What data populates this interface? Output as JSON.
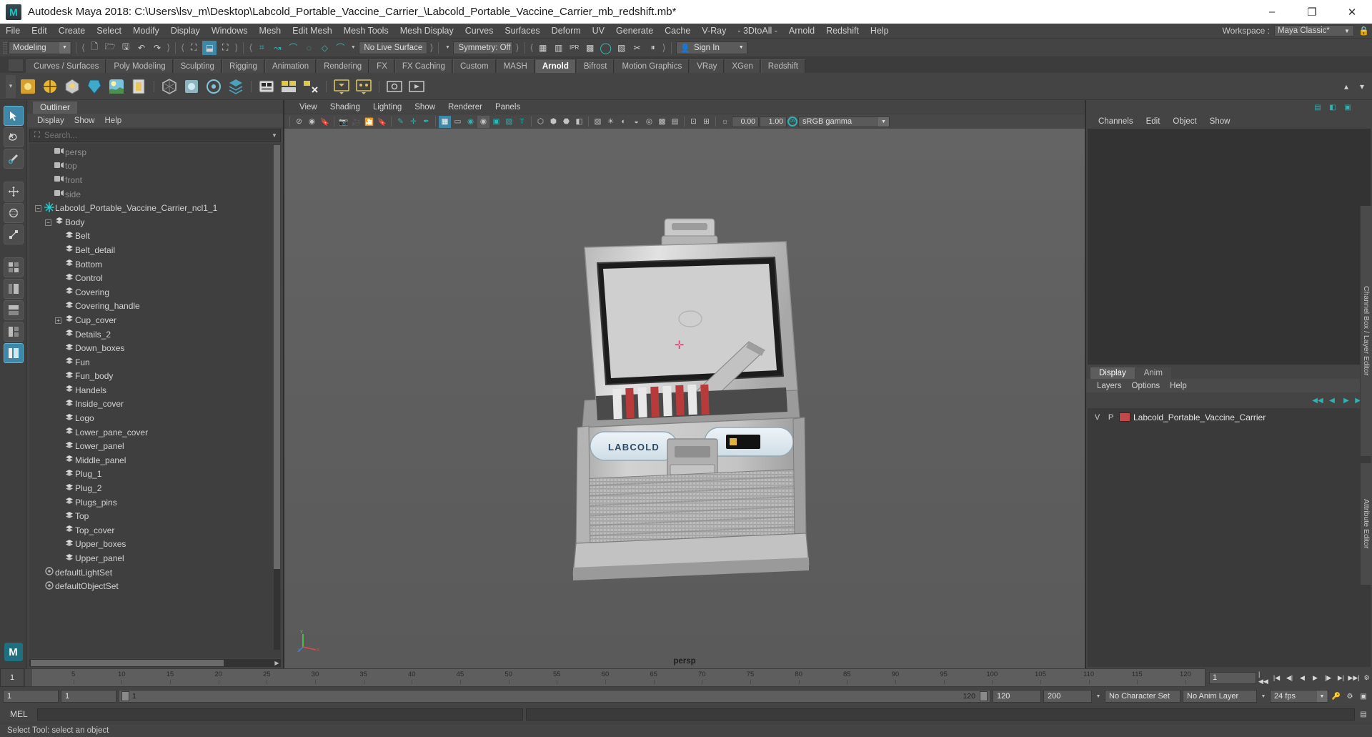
{
  "window": {
    "title": "Autodesk Maya 2018: C:\\Users\\lsv_m\\Desktop\\Labcold_Portable_Vaccine_Carrier_\\Labcold_Portable_Vaccine_Carrier_mb_redshift.mb*",
    "logo": "M",
    "minimize": "–",
    "maximize": "❐",
    "close": "✕"
  },
  "menubar": {
    "items": [
      "File",
      "Edit",
      "Create",
      "Select",
      "Modify",
      "Display",
      "Windows",
      "Mesh",
      "Edit Mesh",
      "Mesh Tools",
      "Mesh Display",
      "Curves",
      "Surfaces",
      "Deform",
      "UV",
      "Generate",
      "Cache",
      "V-Ray",
      "- 3DtoAll -",
      "Arnold",
      "Redshift",
      "Help"
    ],
    "workspace_label": "Workspace :",
    "workspace_value": "Maya Classic*",
    "lock_icon": "lock-icon"
  },
  "statusline": {
    "mode": "Modeling",
    "live_surface": "No Live Surface",
    "symmetry": "Symmetry: Off",
    "signin": "Sign In",
    "icons": [
      "new-scene-icon",
      "open-scene-icon",
      "save-scene-icon",
      "undo-icon",
      "redo-icon",
      "select-hierarchy-icon",
      "select-object-icon",
      "select-component-icon",
      "snap-grid-icon",
      "snap-curve-icon",
      "snap-point-icon",
      "snap-projected-icon",
      "snap-view-plane-icon",
      "magnet-icon",
      "render-current-frame-icon",
      "ipr-render-icon",
      "render-settings-icon",
      "hypershade-icon",
      "render-view-icon",
      "toggle-render-icon",
      "pause-icon"
    ]
  },
  "shelf": {
    "tabs": [
      "Curves / Surfaces",
      "Poly Modeling",
      "Sculpting",
      "Rigging",
      "Animation",
      "Rendering",
      "FX",
      "FX Caching",
      "Custom",
      "MASH",
      "Arnold",
      "Bifrost",
      "Motion Graphics",
      "VRay",
      "XGen",
      "Redshift"
    ],
    "active_tab": "Arnold",
    "buttons": [
      "arnold-area-light-icon",
      "arnold-skydome-light-icon",
      "arnold-mesh-light-icon",
      "arnold-photometric-light-icon",
      "arnold-physical-sky-icon",
      "arnold-light-portal-icon",
      "arnold-standin-icon",
      "arnold-volume-icon",
      "arnold-procedural-icon",
      "arnold-scene-source-icon",
      "arnold-flare-icon",
      "arnold-bifrost-icon",
      "arnold-utility-icon",
      "arnold-render-view-icon",
      "arnold-sequence-icon"
    ]
  },
  "toolbox": {
    "tools": [
      "select-tool",
      "lasso-select-tool",
      "paint-select-tool",
      "move-tool",
      "rotate-tool",
      "scale-tool",
      "last-tool",
      "show-manipulator-tool",
      "layout-quad-icon",
      "layout-persp-outliner-icon",
      "layout-persp-graph-icon",
      "layout-hypershade-icon",
      "layout-outliner-persp-icon"
    ],
    "selected": "select-tool",
    "badge": "M"
  },
  "outliner": {
    "tab": "Outliner",
    "menus": [
      "Display",
      "Show",
      "Help"
    ],
    "search_placeholder": "Search...",
    "search_icon": "search-icon",
    "nodes": [
      {
        "label": "persp",
        "icon": "camera-icon",
        "depth": 1,
        "dim": true,
        "expander": "none"
      },
      {
        "label": "top",
        "icon": "camera-icon",
        "depth": 1,
        "dim": true,
        "expander": "none"
      },
      {
        "label": "front",
        "icon": "camera-icon",
        "depth": 1,
        "dim": true,
        "expander": "none"
      },
      {
        "label": "side",
        "icon": "camera-icon",
        "depth": 1,
        "dim": true,
        "expander": "none"
      },
      {
        "label": "Labcold_Portable_Vaccine_Carrier_ncl1_1",
        "icon": "nucleus-icon",
        "depth": 0,
        "dim": false,
        "expander": "minus"
      },
      {
        "label": "Body",
        "icon": "mesh-icon",
        "depth": 1,
        "dim": false,
        "expander": "minus"
      },
      {
        "label": "Belt",
        "icon": "mesh-icon",
        "depth": 2,
        "dim": false,
        "expander": "dot"
      },
      {
        "label": "Belt_detail",
        "icon": "mesh-icon",
        "depth": 2,
        "dim": false,
        "expander": "dot"
      },
      {
        "label": "Bottom",
        "icon": "mesh-icon",
        "depth": 2,
        "dim": false,
        "expander": "dot"
      },
      {
        "label": "Control",
        "icon": "mesh-icon",
        "depth": 2,
        "dim": false,
        "expander": "dot"
      },
      {
        "label": "Covering",
        "icon": "mesh-icon",
        "depth": 2,
        "dim": false,
        "expander": "dot"
      },
      {
        "label": "Covering_handle",
        "icon": "mesh-icon",
        "depth": 2,
        "dim": false,
        "expander": "dot"
      },
      {
        "label": "Cup_cover",
        "icon": "mesh-icon",
        "depth": 2,
        "dim": false,
        "expander": "plus"
      },
      {
        "label": "Details_2",
        "icon": "mesh-icon",
        "depth": 2,
        "dim": false,
        "expander": "dot"
      },
      {
        "label": "Down_boxes",
        "icon": "mesh-icon",
        "depth": 2,
        "dim": false,
        "expander": "dot"
      },
      {
        "label": "Fun",
        "icon": "mesh-icon",
        "depth": 2,
        "dim": false,
        "expander": "dot"
      },
      {
        "label": "Fun_body",
        "icon": "mesh-icon",
        "depth": 2,
        "dim": false,
        "expander": "dot"
      },
      {
        "label": "Handels",
        "icon": "mesh-icon",
        "depth": 2,
        "dim": false,
        "expander": "dot"
      },
      {
        "label": "Inside_cover",
        "icon": "mesh-icon",
        "depth": 2,
        "dim": false,
        "expander": "dot"
      },
      {
        "label": "Logo",
        "icon": "mesh-icon",
        "depth": 2,
        "dim": false,
        "expander": "dot"
      },
      {
        "label": "Lower_pane_cover",
        "icon": "mesh-icon",
        "depth": 2,
        "dim": false,
        "expander": "dot"
      },
      {
        "label": "Lower_panel",
        "icon": "mesh-icon",
        "depth": 2,
        "dim": false,
        "expander": "dot"
      },
      {
        "label": "Middle_panel",
        "icon": "mesh-icon",
        "depth": 2,
        "dim": false,
        "expander": "dot"
      },
      {
        "label": "Plug_1",
        "icon": "mesh-icon",
        "depth": 2,
        "dim": false,
        "expander": "dot"
      },
      {
        "label": "Plug_2",
        "icon": "mesh-icon",
        "depth": 2,
        "dim": false,
        "expander": "dot"
      },
      {
        "label": "Plugs_pins",
        "icon": "mesh-icon",
        "depth": 2,
        "dim": false,
        "expander": "dot"
      },
      {
        "label": "Top",
        "icon": "mesh-icon",
        "depth": 2,
        "dim": false,
        "expander": "dot"
      },
      {
        "label": "Top_cover",
        "icon": "mesh-icon",
        "depth": 2,
        "dim": false,
        "expander": "dot"
      },
      {
        "label": "Upper_boxes",
        "icon": "mesh-icon",
        "depth": 2,
        "dim": false,
        "expander": "dot"
      },
      {
        "label": "Upper_panel",
        "icon": "mesh-icon",
        "depth": 2,
        "dim": false,
        "expander": "dot"
      },
      {
        "label": "defaultLightSet",
        "icon": "set-icon",
        "depth": 0,
        "dim": false,
        "expander": "none"
      },
      {
        "label": "defaultObjectSet",
        "icon": "set-icon",
        "depth": 0,
        "dim": false,
        "expander": "none"
      }
    ]
  },
  "viewport": {
    "menus": [
      "View",
      "Shading",
      "Lighting",
      "Show",
      "Renderer",
      "Panels"
    ],
    "camera_label": "persp",
    "exposure": "0.00",
    "gamma": "1.00",
    "color_space": "sRGB gamma",
    "color_mgmt_toggle": "ON",
    "toolbar_icons": [
      "no-camera-icon",
      "select-camera-icon",
      "bookmark-icon",
      "camera-attributes-icon",
      "lock-camera-icon",
      "twoDpanzoom-icon",
      "grease-pencil-icon",
      "image-plane-icon",
      "grid-toggle-icon",
      "film-gate-icon",
      "resolution-gate-icon",
      "gate-mask-icon",
      "film-origin-icon",
      "xray-icon",
      "xray-joints-icon",
      "text-icon",
      "wireframe-icon",
      "smooth-shade-icon",
      "textured-icon",
      "use-all-lights-icon",
      "shadows-icon",
      "ao-icon",
      "motion-blur-icon",
      "multisample-icon",
      "depth-peeling-icon",
      "isolate-select-icon"
    ],
    "model_brand": "LABCOLD"
  },
  "channelbox": {
    "menus": [
      "Channels",
      "Edit",
      "Object",
      "Show"
    ],
    "side_label": "Channel Box / Layer Editor",
    "side_label2": "Attribute Editor",
    "header_icons": [
      "channel-box-icon",
      "attribute-editor-icon",
      "show-hide-icon"
    ]
  },
  "layer_editor": {
    "tabs": [
      "Display",
      "Anim"
    ],
    "active_tab": "Display",
    "menus": [
      "Layers",
      "Options",
      "Help"
    ],
    "button_icons": [
      "layer-first-icon",
      "layer-prev-icon",
      "layer-next-icon",
      "layer-last-icon"
    ],
    "columns": [
      "V",
      "P"
    ],
    "layers": [
      {
        "v": "V",
        "p": "P",
        "color": "#c04a4a",
        "name": "Labcold_Portable_Vaccine_Carrier"
      }
    ]
  },
  "timeline": {
    "current_frame": "1",
    "ticks": [
      "5",
      "10",
      "15",
      "20",
      "25",
      "30",
      "35",
      "40",
      "45",
      "50",
      "55",
      "60",
      "65",
      "70",
      "75",
      "80",
      "85",
      "90",
      "95",
      "100",
      "105",
      "110",
      "115",
      "120"
    ],
    "frame_field": "1",
    "playback_icons": [
      "go-to-start-icon",
      "step-back-key-icon",
      "step-back-frame-icon",
      "play-backwards-icon",
      "play-forwards-icon",
      "step-forward-frame-icon",
      "step-forward-key-icon",
      "go-to-end-icon"
    ],
    "range_start": "1",
    "range_start2": "1",
    "slider_start": "1",
    "slider_end": "120",
    "range_end": "120",
    "playback_end": "200",
    "character_set": "No Character Set",
    "anim_layer": "No Anim Layer",
    "fps": "24 fps",
    "extra_icons": [
      "auto-key-icon",
      "animation-preferences-icon",
      "playback-options-icon"
    ]
  },
  "commandline": {
    "label": "MEL",
    "input_value": "",
    "help_icon": "script-editor-icon"
  },
  "statusbar": {
    "message": "Select Tool: select an object"
  }
}
